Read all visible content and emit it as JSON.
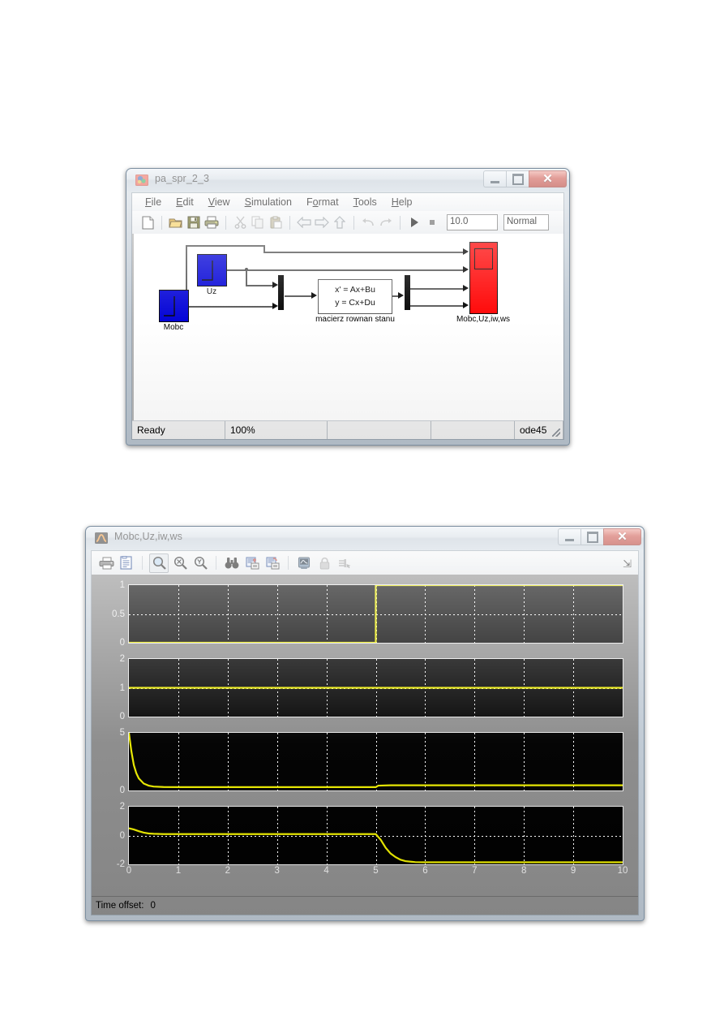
{
  "simulink_window": {
    "title": "pa_spr_2_3",
    "icon": "simulink-model-icon",
    "window_buttons": {
      "minimize": "minimize-icon",
      "maximize": "maximize-icon",
      "close": "close-icon"
    },
    "menus": [
      {
        "label": "File",
        "mnemonic": "F"
      },
      {
        "label": "Edit",
        "mnemonic": "E"
      },
      {
        "label": "View",
        "mnemonic": "V"
      },
      {
        "label": "Simulation",
        "mnemonic": "S"
      },
      {
        "label": "Format",
        "mnemonic": "o"
      },
      {
        "label": "Tools",
        "mnemonic": "T"
      },
      {
        "label": "Help",
        "mnemonic": "H"
      }
    ],
    "toolbar": {
      "icons": [
        "new-model-icon",
        "open-model-icon",
        "save-icon",
        "print-icon",
        "cut-icon",
        "copy-icon",
        "paste-icon",
        "go-back-icon",
        "go-forward-icon",
        "go-up-icon",
        "undo-icon",
        "redo-icon",
        "start-simulation-icon",
        "stop-simulation-icon"
      ],
      "stop_time": "10.0",
      "sim_mode": "Normal"
    },
    "diagram": {
      "blocks": [
        {
          "name": "Mobc",
          "type": "step",
          "label": "Mobc"
        },
        {
          "name": "Uz",
          "type": "step",
          "label": "Uz"
        },
        {
          "name": "state-space",
          "type": "state-space",
          "line1": "x' = Ax+Bu",
          "line2": "y = Cx+Du",
          "label": "macierz rownan stanu"
        },
        {
          "name": "scope",
          "type": "scope",
          "label": "Mobc,Uz,iw,ws"
        },
        {
          "name": "mux-1",
          "type": "mux"
        },
        {
          "name": "demux-1",
          "type": "demux"
        }
      ]
    },
    "statusbar": {
      "state": "Ready",
      "zoom": "100%",
      "field3": "",
      "field4": "",
      "solver": "ode45"
    }
  },
  "scope_window": {
    "title": "Mobc,Uz,iw,ws",
    "icon": "matlab-scope-icon",
    "window_buttons": {
      "minimize": "minimize-icon",
      "maximize": "maximize-icon",
      "close": "close-icon"
    },
    "toolbar_icons": [
      "print-icon",
      "parameters-icon",
      "zoom-box-icon",
      "zoom-x-icon",
      "zoom-y-icon",
      "autoscale-binoculars-icon",
      "save-axes-settings-icon",
      "restore-axes-settings-icon",
      "floating-scope-icon",
      "lock-axes-icon",
      "signal-selection-icon"
    ],
    "dock_icon": "dock-arrow-icon",
    "status": {
      "label": "Time offset:",
      "value": "0"
    }
  },
  "chart_data": [
    {
      "type": "line",
      "name": "Mobc",
      "title": "",
      "xlabel": "",
      "ylabel": "",
      "xlim": [
        0,
        10
      ],
      "ylim": [
        0,
        1
      ],
      "yticks": [
        "1",
        "0.5",
        "0"
      ],
      "ytick_values": [
        1,
        0.5,
        0
      ],
      "xticks": [],
      "grid": true,
      "line_color": "#e8e800",
      "x": [
        0,
        1,
        2,
        3,
        4,
        5,
        5,
        6,
        7,
        8,
        9,
        10
      ],
      "y": [
        0,
        0,
        0,
        0,
        0,
        0,
        1,
        1,
        1,
        1,
        1,
        1
      ]
    },
    {
      "type": "line",
      "name": "Uz",
      "title": "",
      "xlabel": "",
      "ylabel": "",
      "xlim": [
        0,
        10
      ],
      "ylim": [
        0,
        2
      ],
      "yticks": [
        "2",
        "1",
        "0"
      ],
      "ytick_values": [
        2,
        1,
        0
      ],
      "xticks": [],
      "grid": true,
      "line_color": "#e8e800",
      "x": [
        0,
        1,
        2,
        3,
        4,
        5,
        6,
        7,
        8,
        9,
        10
      ],
      "y": [
        1,
        1,
        1,
        1,
        1,
        1,
        1,
        1,
        1,
        1,
        1
      ]
    },
    {
      "type": "line",
      "name": "iw",
      "title": "",
      "xlabel": "",
      "ylabel": "",
      "xlim": [
        0,
        10
      ],
      "ylim": [
        0,
        5
      ],
      "yticks": [
        "5",
        "0"
      ],
      "ytick_values": [
        5,
        0
      ],
      "xticks": [],
      "grid": true,
      "line_color": "#e8e800",
      "x": [
        0,
        0.05,
        0.1,
        0.15,
        0.2,
        0.3,
        0.4,
        0.5,
        0.7,
        1,
        2,
        3,
        4,
        5,
        5.05,
        5.3,
        6,
        7,
        8,
        9,
        10
      ],
      "y": [
        5,
        3.4,
        2.2,
        1.5,
        1.05,
        0.6,
        0.42,
        0.34,
        0.3,
        0.29,
        0.29,
        0.29,
        0.29,
        0.29,
        0.42,
        0.45,
        0.45,
        0.45,
        0.45,
        0.45,
        0.45
      ]
    },
    {
      "type": "line",
      "name": "ws",
      "title": "",
      "xlabel": "",
      "ylabel": "",
      "xlim": [
        0,
        10
      ],
      "ylim": [
        -2,
        2
      ],
      "yticks": [
        "2",
        "0",
        "-2"
      ],
      "ytick_values": [
        2,
        0,
        -2
      ],
      "xticks": [
        "0",
        "1",
        "2",
        "3",
        "4",
        "5",
        "6",
        "7",
        "8",
        "9",
        "10"
      ],
      "xtick_values": [
        0,
        1,
        2,
        3,
        4,
        5,
        6,
        7,
        8,
        9,
        10
      ],
      "grid": true,
      "line_color": "#e8e800",
      "x": [
        0,
        0.1,
        0.2,
        0.3,
        0.4,
        0.5,
        0.7,
        1,
        2,
        3,
        4,
        5,
        5.1,
        5.2,
        5.3,
        5.4,
        5.5,
        5.6,
        5.8,
        6,
        7,
        8,
        9,
        10
      ],
      "y": [
        0.5,
        0.42,
        0.3,
        0.2,
        0.14,
        0.12,
        0.1,
        0.1,
        0.1,
        0.1,
        0.1,
        0.1,
        -0.3,
        -0.85,
        -1.25,
        -1.5,
        -1.68,
        -1.78,
        -1.85,
        -1.86,
        -1.86,
        -1.86,
        -1.86,
        -1.86
      ]
    }
  ],
  "colors": {
    "step_block": "#0000d6",
    "scope_block": "#ff0000",
    "plot_bg": "#000000",
    "plot_line": "#e8e800",
    "scope_chrome": "#8c8c8c"
  }
}
